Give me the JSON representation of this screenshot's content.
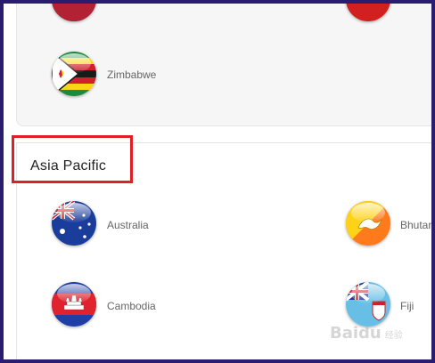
{
  "regions": [
    {
      "name": "",
      "countries": [
        {
          "label": "Zimbabwe",
          "icon": "zimbabwe-flag-icon"
        }
      ]
    },
    {
      "name": "Asia Pacific",
      "highlighted": true,
      "highlight_color": "#e01e26",
      "countries": [
        {
          "label": "Australia",
          "icon": "australia-flag-icon"
        },
        {
          "label": "Bhutan",
          "icon": "bhutan-flag-icon"
        },
        {
          "label": "Cambodia",
          "icon": "cambodia-flag-icon"
        },
        {
          "label": "Fiji",
          "icon": "fiji-flag-icon"
        }
      ]
    }
  ],
  "watermark": {
    "text": "Baidu",
    "sub": "经验"
  }
}
